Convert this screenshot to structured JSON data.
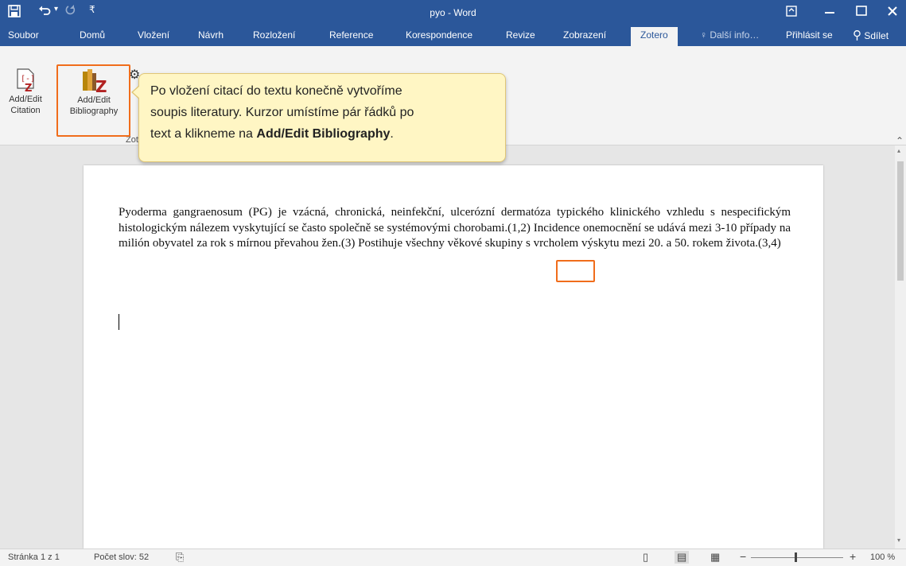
{
  "window": {
    "title": "pyo - Word"
  },
  "quick_access": {
    "save_icon": "save-icon",
    "undo_icon": "undo-icon",
    "redo_icon": "redo-icon",
    "customize_icon": "customize-icon"
  },
  "window_controls": {
    "ribbon_display_icon": "ribbon-display-icon",
    "minimize_icon": "minimize-icon",
    "maximize_icon": "maximize-icon",
    "close_icon": "close-icon"
  },
  "tabs": [
    "Soubor",
    "Domů",
    "Vložení",
    "Návrh",
    "Rozložení",
    "Reference",
    "Korespondence",
    "Revize",
    "Zobrazení",
    "Zotero"
  ],
  "tab_active": "Zotero",
  "tellme": "Další info…",
  "signin": "Přihlásit se",
  "share": "Sdílet",
  "ribbon": {
    "add_edit_citation": "Add/Edit Citation",
    "add_edit_bibliography": "Add/Edit Bibliography",
    "group_label": "Zot"
  },
  "callout": {
    "line1": "Po vložení citací do textu konečně vytvoříme",
    "line2": "soupis literatury. Kurzor umístíme pár řádků po",
    "line3_pre": "text a klikneme na ",
    "line3_bold": "Add/Edit Bibliography",
    "line3_post": "."
  },
  "document": {
    "text_before_citation": "Pyoderma gangraenosum (PG) je vzácná, chronická, neinfekční, ulcerózní dermatóza typického klinického vzhledu s nespecifickým histologickým nálezem vyskytující se často společně se systémovými chorobami.(1,2) Incidence onemocnění se udává mezi 3-10 případy na milión obyvatel za rok s mírnou převahou žen.(3) Postihuje všechny věkové skupiny s vrcholem výskytu mezi 20. a 50. rokem života.",
    "last_citation": "(3,4)"
  },
  "status": {
    "page": "Stránka 1 z 1",
    "words": "Počet slov: 52",
    "zoom": "100 %"
  },
  "colors": {
    "accent": "#2b579a",
    "highlight": "#f06d1b",
    "callout_bg": "#fff6c4"
  }
}
